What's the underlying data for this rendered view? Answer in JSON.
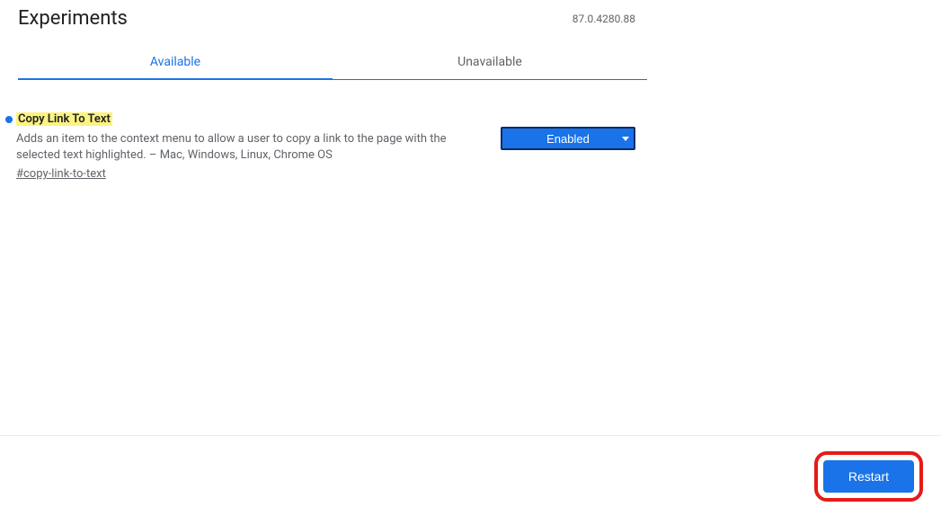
{
  "header": {
    "title": "Experiments",
    "version": "87.0.4280.88"
  },
  "tabs": {
    "available": "Available",
    "unavailable": "Unavailable"
  },
  "flag": {
    "title": "Copy Link To Text",
    "description": "Adds an item to the context menu to allow a user to copy a link to the page with the selected text highlighted. – Mac, Windows, Linux, Chrome OS",
    "hash": "#copy-link-to-text",
    "selected": "Enabled"
  },
  "footer": {
    "restart": "Restart"
  }
}
